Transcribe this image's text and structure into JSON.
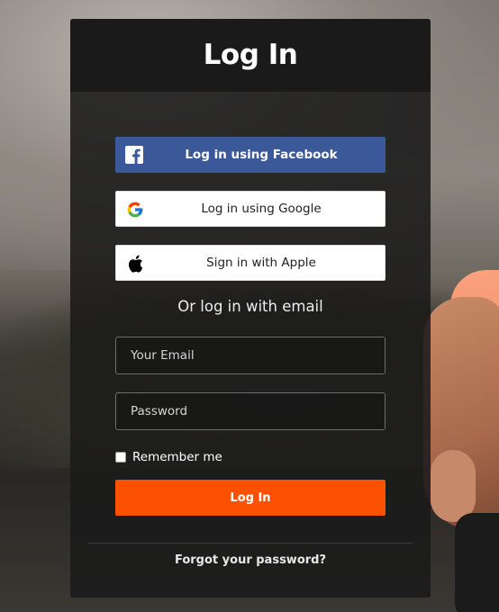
{
  "page": {
    "title": "Log In"
  },
  "social": {
    "facebook_label": "Log in using Facebook",
    "google_label": "Log in using Google",
    "apple_label": "Sign in with Apple"
  },
  "email_login": {
    "divider_text": "Or log in with email",
    "email_placeholder": "Your Email",
    "password_placeholder": "Password",
    "remember_label": "Remember me",
    "remember_checked": false,
    "submit_label": "Log In"
  },
  "footer": {
    "forgot_link": "Forgot your password?"
  },
  "colors": {
    "brand_orange": "#fc5200",
    "facebook_blue": "#3b5998",
    "card_background": "#1a1a1a"
  },
  "icons": {
    "facebook": "facebook-icon",
    "google": "google-icon",
    "apple": "apple-icon"
  }
}
